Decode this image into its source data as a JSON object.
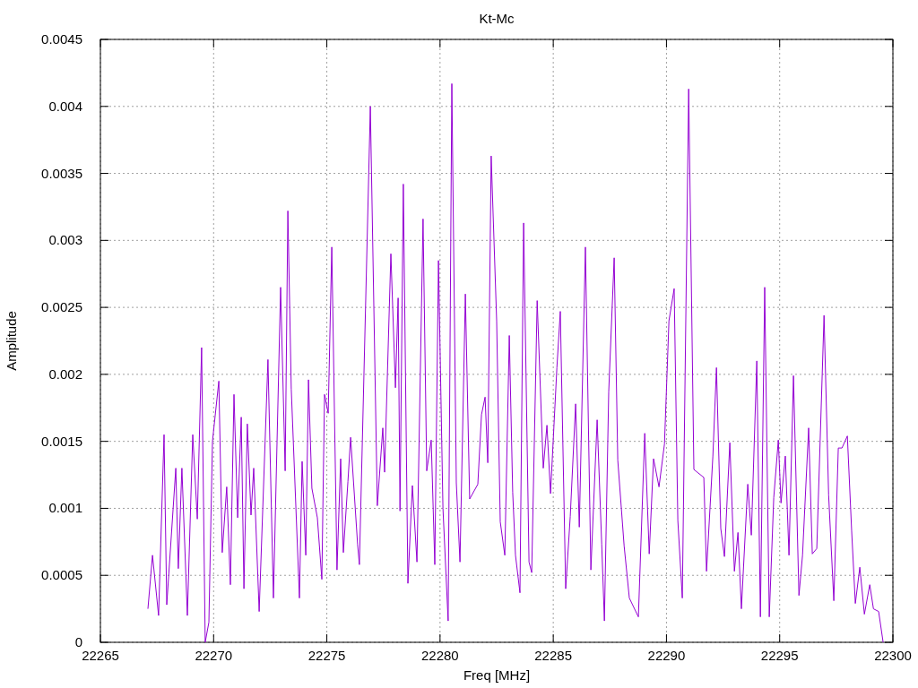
{
  "chart_data": {
    "type": "line",
    "title": "Kt-Mc",
    "xlabel": "Freq [MHz]",
    "ylabel": "Amplitude",
    "xlim": [
      22265,
      22300
    ],
    "ylim": [
      0,
      0.0045
    ],
    "xticks": [
      22265,
      22270,
      22275,
      22280,
      22285,
      22290,
      22295,
      22300
    ],
    "yticks": [
      {
        "value": 0,
        "label": "0"
      },
      {
        "value": 0.0005,
        "label": "0.0005"
      },
      {
        "value": 0.001,
        "label": "0.001"
      },
      {
        "value": 0.0015,
        "label": "0.0015"
      },
      {
        "value": 0.002,
        "label": "0.002"
      },
      {
        "value": 0.0025,
        "label": "0.0025"
      },
      {
        "value": 0.003,
        "label": "0.003"
      },
      {
        "value": 0.0035,
        "label": "0.0035"
      },
      {
        "value": 0.004,
        "label": "0.004"
      },
      {
        "value": 0.0045,
        "label": "0.0045"
      }
    ],
    "x": [
      22267.1,
      22267.3,
      22267.57,
      22267.81,
      22267.93,
      22268.33,
      22268.44,
      22268.6,
      22268.84,
      22269.08,
      22269.28,
      22269.47,
      22269.63,
      22269.79,
      22269.95,
      22270.23,
      22270.38,
      22270.58,
      22270.74,
      22270.9,
      22271.06,
      22271.22,
      22271.34,
      22271.49,
      22271.65,
      22271.77,
      22272.01,
      22272.4,
      22272.64,
      22272.96,
      22273.16,
      22273.28,
      22273.43,
      22273.79,
      22273.91,
      22274.07,
      22274.19,
      22274.34,
      22274.58,
      22274.78,
      22274.9,
      22275.06,
      22275.22,
      22275.45,
      22275.61,
      22275.73,
      22275.93,
      22276.05,
      22276.36,
      22276.44,
      22276.92,
      22277.23,
      22277.47,
      22277.55,
      22277.83,
      22278.03,
      22278.15,
      22278.23,
      22278.38,
      22278.58,
      22278.78,
      22278.98,
      22279.25,
      22279.41,
      22279.61,
      22279.77,
      22279.93,
      22280.13,
      22280.36,
      22280.52,
      22280.72,
      22280.88,
      22281.12,
      22281.31,
      22281.67,
      22281.83,
      22281.99,
      22282.11,
      22282.26,
      22282.5,
      22282.66,
      22282.86,
      22283.06,
      22283.21,
      22283.33,
      22283.53,
      22283.69,
      22283.93,
      22284.05,
      22284.29,
      22284.56,
      22284.72,
      22284.88,
      22285.16,
      22285.31,
      22285.55,
      22285.75,
      22285.99,
      22286.15,
      22286.42,
      22286.66,
      22286.94,
      22287.14,
      22287.26,
      22287.45,
      22287.69,
      22287.85,
      22288.13,
      22288.36,
      22288.76,
      22289.04,
      22289.24,
      22289.43,
      22289.67,
      22289.91,
      22290.11,
      22290.34,
      22290.5,
      22290.7,
      22290.98,
      22291.21,
      22291.65,
      22291.77,
      22292.05,
      22292.21,
      22292.4,
      22292.56,
      22292.8,
      22293.0,
      22293.16,
      22293.31,
      22293.59,
      22293.75,
      22293.99,
      22294.15,
      22294.34,
      22294.54,
      22294.74,
      22294.94,
      22295.06,
      22295.25,
      22295.41,
      22295.61,
      22295.85,
      22296.01,
      22296.28,
      22296.44,
      22296.64,
      22296.96,
      22297.16,
      22297.39,
      22297.59,
      22297.75,
      22297.99,
      22298.18,
      22298.34,
      22298.54,
      22298.74,
      22298.98,
      22299.14,
      22299.37,
      22299.57
    ],
    "series": [
      {
        "color": "#9400d3",
        "values": [
          0.00025,
          0.00065,
          0.0002,
          0.00155,
          0.00028,
          0.0013,
          0.00055,
          0.0013,
          0.0002,
          0.00155,
          0.00092,
          0.0022,
          0,
          0.00015,
          0.0015,
          0.00195,
          0.00067,
          0.00116,
          0.00043,
          0.00185,
          0.00093,
          0.00168,
          0.0004,
          0.00163,
          0.00095,
          0.0013,
          0.00023,
          0.00211,
          0.00033,
          0.00265,
          0.00128,
          0.00322,
          0.00189,
          0.00033,
          0.00135,
          0.00065,
          0.00196,
          0.00115,
          0.00093,
          0.00047,
          0.00185,
          0.00171,
          0.00295,
          0.00054,
          0.00137,
          0.00067,
          0.0012,
          0.00153,
          0.00073,
          0.00058,
          0.004,
          0.00102,
          0.0016,
          0.00127,
          0.0029,
          0.0019,
          0.00257,
          0.00098,
          0.00342,
          0.00044,
          0.00117,
          0.0006,
          0.00316,
          0.00128,
          0.00151,
          0.00058,
          0.00285,
          0.001,
          0.00016,
          0.00417,
          0.00119,
          0.0006,
          0.0026,
          0.00107,
          0.00118,
          0.0017,
          0.00183,
          0.00134,
          0.00363,
          0.0024,
          0.0009,
          0.00065,
          0.00229,
          0.00112,
          0.00065,
          0.00037,
          0.00313,
          0.0006,
          0.00052,
          0.00255,
          0.0013,
          0.00162,
          0.00111,
          0.00205,
          0.00247,
          0.0004,
          0.00094,
          0.00178,
          0.00086,
          0.00295,
          0.00054,
          0.00166,
          0.00073,
          0.00016,
          0.00187,
          0.00287,
          0.00136,
          0.00072,
          0.00033,
          0.00019,
          0.00156,
          0.00066,
          0.00137,
          0.00116,
          0.00148,
          0.0024,
          0.00264,
          0.00091,
          0.00033,
          0.00413,
          0.00129,
          0.00123,
          0.00053,
          0.00139,
          0.00205,
          0.00085,
          0.00064,
          0.00149,
          0.00053,
          0.00082,
          0.00025,
          0.00118,
          0.0008,
          0.0021,
          0.00019,
          0.00265,
          0.00019,
          0.00108,
          0.00151,
          0.00104,
          0.00139,
          0.00065,
          0.00199,
          0.00035,
          0.00065,
          0.0016,
          0.00066,
          0.0007,
          0.00244,
          0.0011,
          0.00031,
          0.00145,
          0.00145,
          0.00154,
          0.00083,
          0.00029,
          0.00056,
          0.00021,
          0.00043,
          0.00025,
          0.00023,
          0
        ]
      }
    ],
    "grid": true
  }
}
